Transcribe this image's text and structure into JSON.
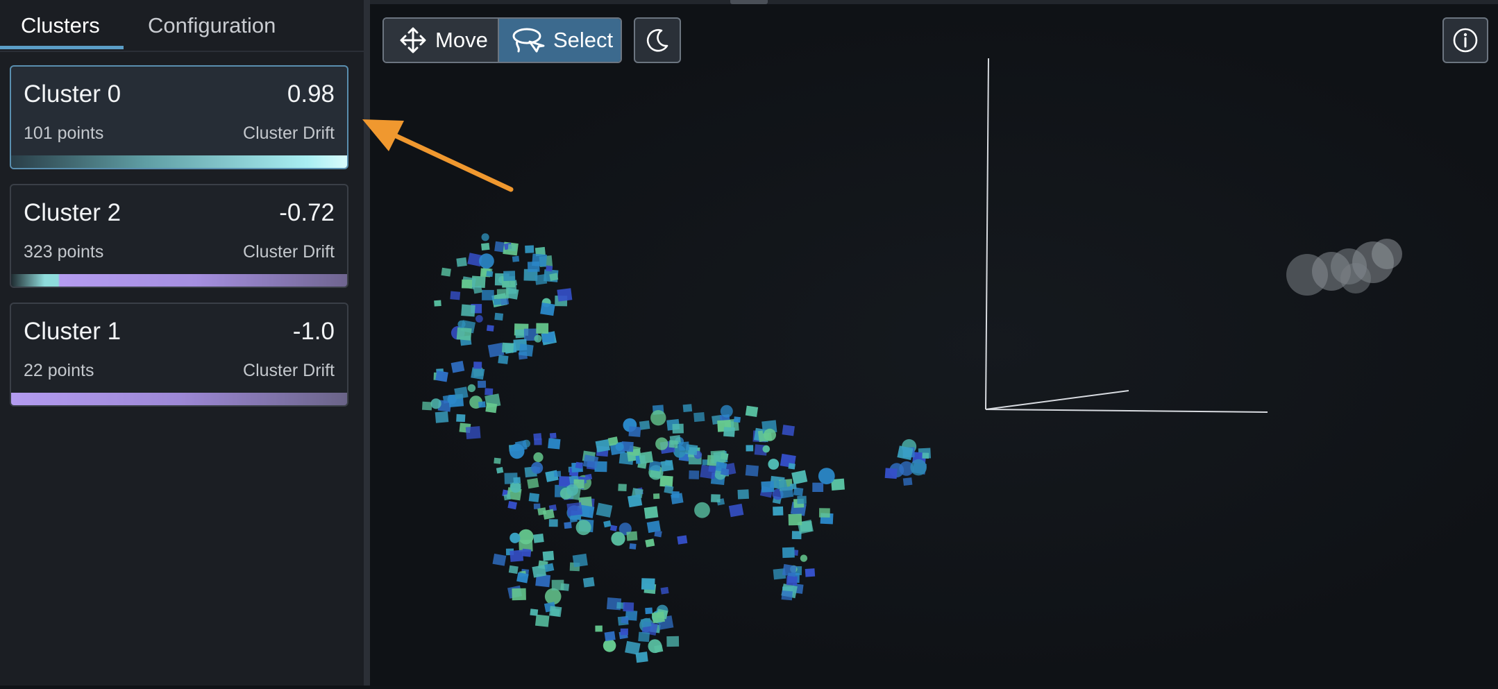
{
  "tabs": [
    {
      "label": "Clusters",
      "active": true
    },
    {
      "label": "Configuration",
      "active": false
    }
  ],
  "clusters": [
    {
      "name": "Cluster 0",
      "score": "0.98",
      "points": "101 points",
      "metric": "Cluster Drift",
      "selected": true,
      "drift": 0.98
    },
    {
      "name": "Cluster 2",
      "score": "-0.72",
      "points": "323 points",
      "metric": "Cluster Drift",
      "selected": false,
      "drift": -0.72
    },
    {
      "name": "Cluster 1",
      "score": "-1.0",
      "points": "22 points",
      "metric": "Cluster Drift",
      "selected": false,
      "drift": -1.0
    }
  ],
  "toolbar": {
    "move_label": "Move",
    "select_label": "Select",
    "theme_icon": "moon-icon",
    "info_icon": "info-icon"
  },
  "colors": {
    "accent": "#5b9ec7",
    "selected_button": "#3c6a8e",
    "annotation_arrow": "#f0982f",
    "positive_drift": "#a8eef2",
    "negative_drift": "#b49cf0"
  }
}
